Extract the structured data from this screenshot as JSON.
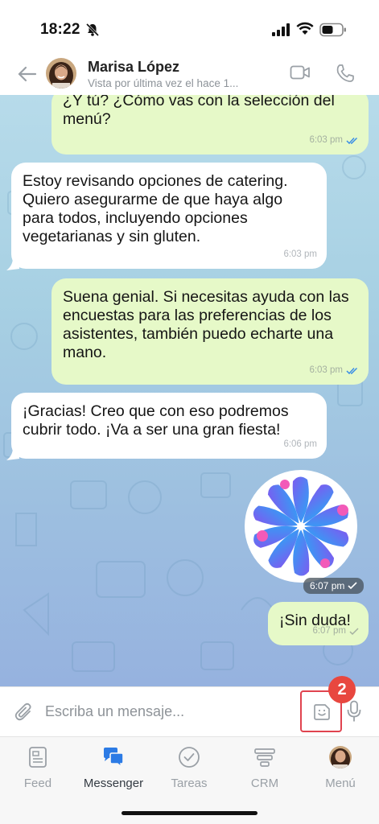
{
  "status": {
    "time": "18:22"
  },
  "header": {
    "name": "Marisa López",
    "status": "Vista por última vez el hace 1..."
  },
  "messages": [
    {
      "dir": "out",
      "text": "¿Y tú? ¿Cómo vas con la selección del menú?",
      "time": "6:03 pm",
      "read": true
    },
    {
      "dir": "in",
      "text": "Estoy revisando opciones de catering. Quiero asegurarme de que haya algo para todos, incluyendo opciones vegetarianas y sin gluten.",
      "time": "6:03 pm"
    },
    {
      "dir": "out",
      "text": "Suena genial. Si necesitas ayuda con las encuestas para las preferencias de los asistentes, también puedo echarte una mano.",
      "time": "6:03 pm",
      "read": true
    },
    {
      "dir": "in",
      "text": "¡Gracias! Creo que con eso podremos cubrir todo. ¡Va a ser una gran fiesta!",
      "time": "6:06 pm"
    },
    {
      "dir": "out",
      "type": "sticker",
      "time": "6:07 pm"
    },
    {
      "dir": "out",
      "text": "¡Sin duda!",
      "time": "6:07 pm"
    }
  ],
  "input": {
    "placeholder": "Escriba un mensaje..."
  },
  "badge_count": "2",
  "tabs": [
    {
      "label": "Feed",
      "icon": "feed-icon"
    },
    {
      "label": "Messenger",
      "icon": "messenger-icon",
      "active": true
    },
    {
      "label": "Tareas",
      "icon": "tasks-icon"
    },
    {
      "label": "CRM",
      "icon": "crm-icon"
    },
    {
      "label": "Menú",
      "icon": "avatar"
    }
  ],
  "colors": {
    "outgoing_bubble": "#e6f9c8",
    "incoming_bubble": "#ffffff",
    "accent_blue": "#2c7be5",
    "badge_red": "#e8473f"
  }
}
